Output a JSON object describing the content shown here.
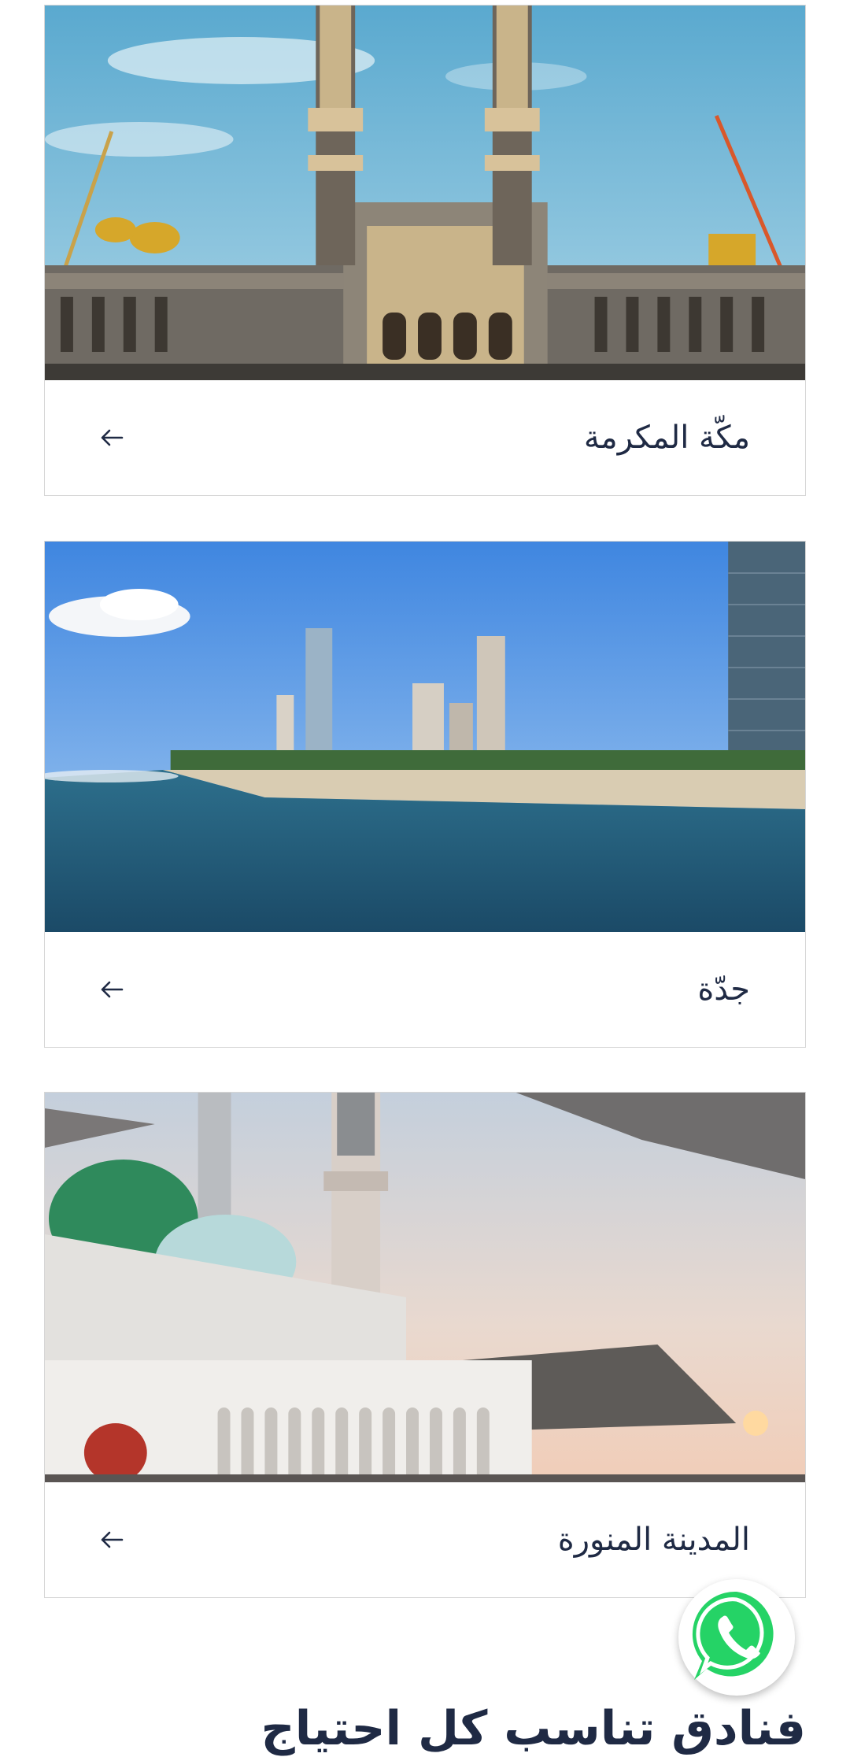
{
  "destinations": [
    {
      "title": "مكّة المكرمة",
      "image_icon": "makkah-clock-tower-image",
      "arrow": "arrow-left-icon"
    },
    {
      "title": "جدّة",
      "image_icon": "jeddah-corniche-image",
      "arrow": "arrow-left-icon"
    },
    {
      "title": "المدينة المنورة",
      "image_icon": "madinah-prophet-mosque-image",
      "arrow": "arrow-left-icon"
    }
  ],
  "section": {
    "heading": "فنادق تناسب كل احتياج"
  },
  "floating": {
    "whatsapp_icon": "whatsapp-icon",
    "whatsapp_color": "#25D366"
  },
  "colors": {
    "title_text": "#1f2a44",
    "card_border": "#d6d6d6"
  }
}
